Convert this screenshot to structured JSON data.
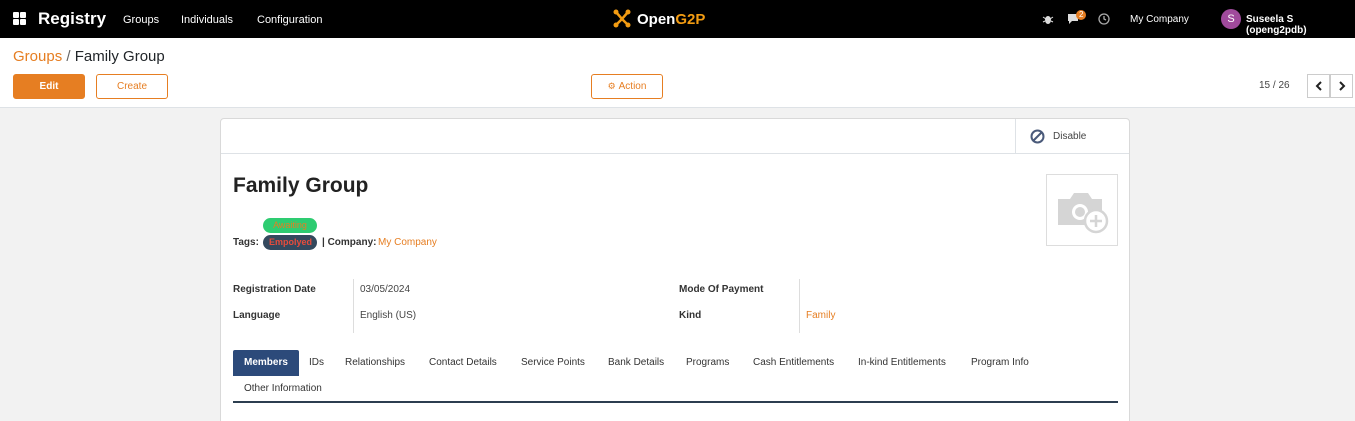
{
  "navbar": {
    "brand": "Registry",
    "menu": [
      "Groups",
      "Individuals",
      "Configuration"
    ],
    "logo_text_a": "Open",
    "logo_text_b": "G2P",
    "chat_count": "2",
    "company": "My Company",
    "avatar_letter": "S",
    "user": "Suseela S (openg2pdb)"
  },
  "breadcrumb": {
    "parent": "Groups",
    "separator": "/",
    "current": "Family Group"
  },
  "buttons": {
    "edit": "Edit",
    "create": "Create",
    "action": "Action"
  },
  "pager": {
    "value": "15 / 26"
  },
  "sheet": {
    "disable": "Disable",
    "title": "Family Group",
    "tags_label": "Tags:",
    "tags": [
      "Awaiting",
      "Empolyed"
    ],
    "company_label": "| Company:",
    "company_value": "My Company",
    "fields": {
      "registration_date_label": "Registration Date",
      "registration_date": "03/05/2024",
      "language_label": "Language",
      "language": "English (US)",
      "mode_of_payment_label": "Mode Of Payment",
      "mode_of_payment": "",
      "kind_label": "Kind",
      "kind": "Family"
    },
    "tabs": [
      "Members",
      "IDs",
      "Relationships",
      "Contact Details",
      "Service Points",
      "Bank Details",
      "Programs",
      "Cash Entitlements",
      "In-kind Entitlements",
      "Program Info",
      "Other Information"
    ]
  },
  "colors": {
    "accent": "#e67e22",
    "navbar": "#000000",
    "tab_active": "#2c4a7a"
  }
}
